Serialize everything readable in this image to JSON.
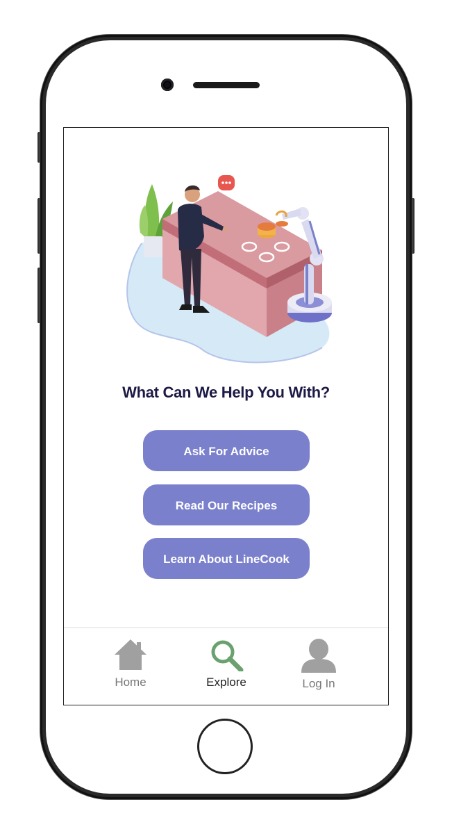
{
  "screen": {
    "heading": "What Can We Help You With?",
    "actions": [
      {
        "label": "Ask For Advice"
      },
      {
        "label": "Read Our Recipes"
      },
      {
        "label": "Learn About LineCook"
      }
    ]
  },
  "tabbar": {
    "tabs": [
      {
        "label": "Home",
        "icon": "home-icon",
        "active": false
      },
      {
        "label": "Explore",
        "icon": "search-icon",
        "active": true
      },
      {
        "label": "Log In",
        "icon": "user-icon",
        "active": false
      }
    ]
  },
  "colors": {
    "button": "#7a80cc",
    "heading": "#1c1a45",
    "active_icon": "#6aa16f",
    "inactive_icon": "#a0a0a0"
  }
}
